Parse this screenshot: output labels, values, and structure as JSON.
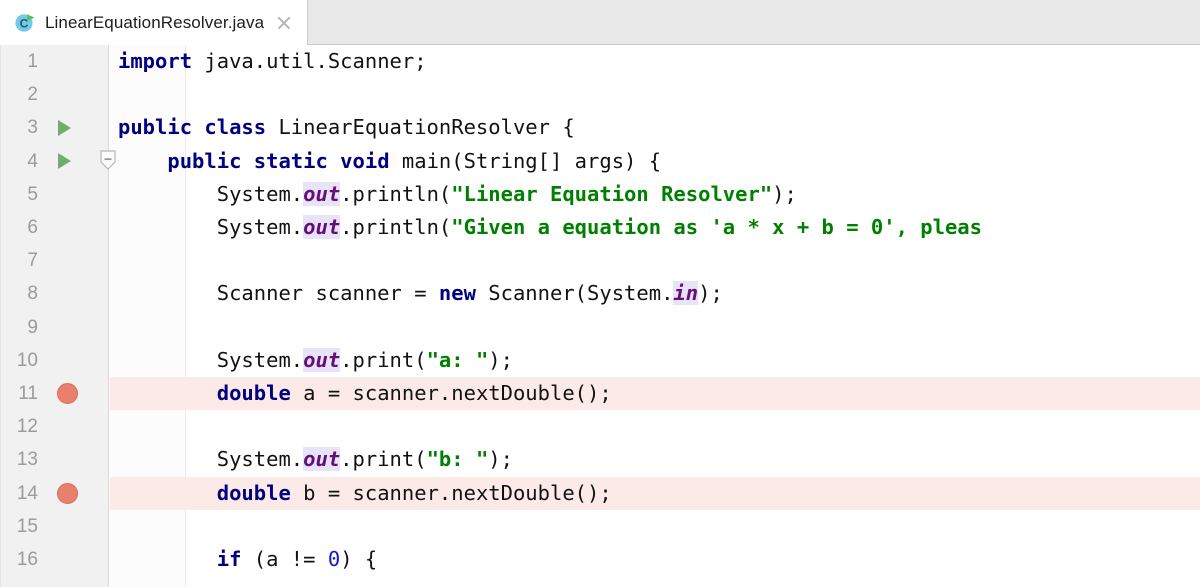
{
  "window": {
    "app": "IntelliJ IDEA Editor"
  },
  "tab": {
    "label": "LinearEquationResolver.java",
    "icon": "java-class-runnable-icon",
    "close_icon": "close-icon",
    "active": true
  },
  "editor": {
    "language": "Java",
    "first_visible_line": 1,
    "last_visible_line": 16,
    "line_height_px": 33.2,
    "colors": {
      "keyword": "#000080",
      "string": "#008000",
      "number": "#1414cc",
      "static_field": "#660e7a",
      "static_field_bg": "#e8e4f7",
      "breakpoint_line_bg": "#fbeae7",
      "breakpoint_dot": "#e8806e",
      "run_arrow": "#5aa05a",
      "gutter_bg": "#f1f1f1",
      "line_number": "#9b9b9b",
      "editor_bg": "#ffffff",
      "tabbar_bg": "#e8e8e8"
    },
    "lines": [
      {
        "n": "1",
        "indent": 0,
        "breakpoint": false,
        "run_arrow": false,
        "fold_marker": false,
        "text": "import java.util.Scanner;",
        "tokens": [
          {
            "t": "import",
            "c": "kw"
          },
          {
            "t": " java.util.Scanner;",
            "c": "plain"
          }
        ]
      },
      {
        "n": "2",
        "indent": 0,
        "breakpoint": false,
        "run_arrow": false,
        "fold_marker": false,
        "text": "",
        "tokens": []
      },
      {
        "n": "3",
        "indent": 0,
        "breakpoint": false,
        "run_arrow": true,
        "fold_marker": false,
        "text": "public class LinearEquationResolver {",
        "tokens": [
          {
            "t": "public class",
            "c": "kw"
          },
          {
            "t": " LinearEquationResolver {",
            "c": "plain"
          }
        ]
      },
      {
        "n": "4",
        "indent": 1,
        "breakpoint": false,
        "run_arrow": true,
        "fold_marker": true,
        "text": "    public static void main(String[] args) {",
        "tokens": [
          {
            "t": "    ",
            "c": "plain"
          },
          {
            "t": "public static void",
            "c": "kw"
          },
          {
            "t": " main(String[] args) {",
            "c": "plain"
          }
        ]
      },
      {
        "n": "5",
        "indent": 2,
        "breakpoint": false,
        "run_arrow": false,
        "fold_marker": false,
        "text": "        System.out.println(\"Linear Equation Resolver\");",
        "tokens": [
          {
            "t": "        System.",
            "c": "plain"
          },
          {
            "t": "out",
            "c": "fld"
          },
          {
            "t": ".println(",
            "c": "plain"
          },
          {
            "t": "\"Linear Equation Resolver\"",
            "c": "str"
          },
          {
            "t": ");",
            "c": "plain"
          }
        ]
      },
      {
        "n": "6",
        "indent": 2,
        "breakpoint": false,
        "run_arrow": false,
        "fold_marker": false,
        "text": "        System.out.println(\"Given a equation as 'a * x + b = 0', pleas",
        "tokens": [
          {
            "t": "        System.",
            "c": "plain"
          },
          {
            "t": "out",
            "c": "fld"
          },
          {
            "t": ".println(",
            "c": "plain"
          },
          {
            "t": "\"Given a equation as 'a * x + b = 0', pleas",
            "c": "str"
          }
        ]
      },
      {
        "n": "7",
        "indent": 0,
        "breakpoint": false,
        "run_arrow": false,
        "fold_marker": false,
        "text": "",
        "tokens": []
      },
      {
        "n": "8",
        "indent": 2,
        "breakpoint": false,
        "run_arrow": false,
        "fold_marker": false,
        "text": "        Scanner scanner = new Scanner(System.in);",
        "tokens": [
          {
            "t": "        Scanner scanner = ",
            "c": "plain"
          },
          {
            "t": "new",
            "c": "kw"
          },
          {
            "t": " Scanner(System.",
            "c": "plain"
          },
          {
            "t": "in",
            "c": "fld"
          },
          {
            "t": ");",
            "c": "plain"
          }
        ]
      },
      {
        "n": "9",
        "indent": 0,
        "breakpoint": false,
        "run_arrow": false,
        "fold_marker": false,
        "text": "",
        "tokens": []
      },
      {
        "n": "10",
        "indent": 2,
        "breakpoint": false,
        "run_arrow": false,
        "fold_marker": false,
        "text": "        System.out.print(\"a: \");",
        "tokens": [
          {
            "t": "        System.",
            "c": "plain"
          },
          {
            "t": "out",
            "c": "fld"
          },
          {
            "t": ".print(",
            "c": "plain"
          },
          {
            "t": "\"a: \"",
            "c": "str"
          },
          {
            "t": ");",
            "c": "plain"
          }
        ]
      },
      {
        "n": "11",
        "indent": 2,
        "breakpoint": true,
        "run_arrow": false,
        "fold_marker": false,
        "text": "        double a = scanner.nextDouble();",
        "tokens": [
          {
            "t": "        ",
            "c": "plain"
          },
          {
            "t": "double",
            "c": "kw"
          },
          {
            "t": " a = scanner.nextDouble();",
            "c": "plain"
          }
        ]
      },
      {
        "n": "12",
        "indent": 0,
        "breakpoint": false,
        "run_arrow": false,
        "fold_marker": false,
        "text": "",
        "tokens": []
      },
      {
        "n": "13",
        "indent": 2,
        "breakpoint": false,
        "run_arrow": false,
        "fold_marker": false,
        "text": "        System.out.print(\"b: \");",
        "tokens": [
          {
            "t": "        System.",
            "c": "plain"
          },
          {
            "t": "out",
            "c": "fld"
          },
          {
            "t": ".print(",
            "c": "plain"
          },
          {
            "t": "\"b: \"",
            "c": "str"
          },
          {
            "t": ");",
            "c": "plain"
          }
        ]
      },
      {
        "n": "14",
        "indent": 2,
        "breakpoint": true,
        "run_arrow": false,
        "fold_marker": false,
        "text": "        double b = scanner.nextDouble();",
        "tokens": [
          {
            "t": "        ",
            "c": "plain"
          },
          {
            "t": "double",
            "c": "kw"
          },
          {
            "t": " b = scanner.nextDouble();",
            "c": "plain"
          }
        ]
      },
      {
        "n": "15",
        "indent": 0,
        "breakpoint": false,
        "run_arrow": false,
        "fold_marker": false,
        "text": "",
        "tokens": []
      },
      {
        "n": "16",
        "indent": 2,
        "breakpoint": false,
        "run_arrow": false,
        "fold_marker": false,
        "text": "        if (a != 0) {",
        "tokens": [
          {
            "t": "        ",
            "c": "plain"
          },
          {
            "t": "if",
            "c": "kw"
          },
          {
            "t": " (a != ",
            "c": "plain"
          },
          {
            "t": "0",
            "c": "num"
          },
          {
            "t": ") {",
            "c": "plain"
          }
        ]
      }
    ]
  }
}
